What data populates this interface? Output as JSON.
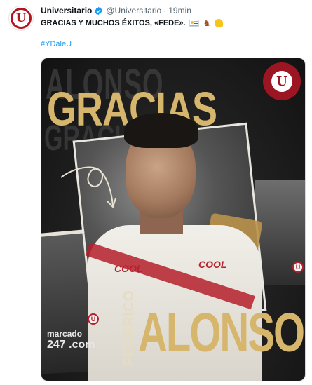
{
  "tweet": {
    "author_name": "Universitario",
    "handle": "@Universitario",
    "separator": "·",
    "time": "19min",
    "text": "GRACIAS Y MUCHOS ÉXITOS, «FEDE».",
    "hashtag": "#YDaleU"
  },
  "avatar": {
    "letter": "U"
  },
  "media": {
    "headline": "GRACIAS",
    "first_name": "FEDERICO",
    "last_name": "ALONSO",
    "background_word": "ALONSO",
    "background_word_2": "GRACIAS",
    "sponsor_left": "COOL",
    "sponsor_right": "COOL",
    "sponsor_bottom_1": "marcado",
    "sponsor_bottom_2": "247 .com",
    "badge_letter": "U"
  },
  "colors": {
    "club_red": "#b3121f",
    "gold": "#d6b56c",
    "link_blue": "#1d9bf0",
    "verified_blue": "#1d9bf0"
  },
  "icons": [
    "verified-badge-icon",
    "uruguay-flag-icon",
    "horse-icon",
    "flexed-biceps-icon"
  ]
}
